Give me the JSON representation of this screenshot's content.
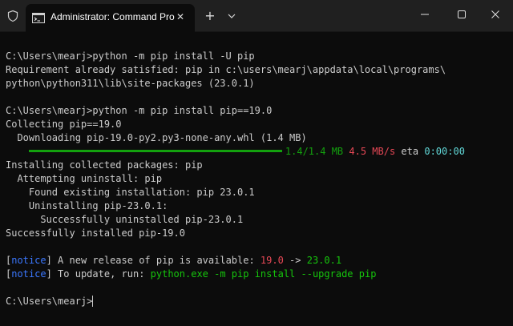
{
  "window": {
    "tab_title": "Administrator: Command Pro",
    "icons": {
      "shield": "shield-icon",
      "tab": "command-prompt-icon",
      "close_tab": "close-icon",
      "new_tab": "plus-icon",
      "dropdown": "chevron-down-icon",
      "minimize": "minimize-icon",
      "maximize": "maximize-icon",
      "close_window": "close-icon"
    }
  },
  "glyphs": {
    "close": "✕",
    "plus": "+"
  },
  "colors": {
    "background": "#0c0c0c",
    "titlebar": "#202020",
    "text": "#cccccc",
    "green": "#13a10e",
    "lime": "#16c60c",
    "red": "#e74856",
    "blue": "#3b78ff",
    "cyan": "#61d6d6"
  },
  "terminal": {
    "cmd1": "C:\\Users\\mearj>python -m pip install -U pip",
    "out1a": "Requirement already satisfied: pip in c:\\users\\mearj\\appdata\\local\\programs\\",
    "out1b": "python\\python311\\lib\\site-packages (23.0.1)",
    "cmd2": "C:\\Users\\mearj>python -m pip install pip==19.0",
    "collecting": "Collecting pip==19.0",
    "downloading": "  Downloading pip-19.0-py2.py3-none-any.whl (1.4 MB)",
    "progress": {
      "fraction": 1.0,
      "size": "1.4/1.4 MB",
      "speed": "4.5 MB/s",
      "eta_label": "eta",
      "eta": "0:00:00"
    },
    "installing": "Installing collected packages: pip",
    "attempting": "  Attempting uninstall: pip",
    "found": "    Found existing installation: pip 23.0.1",
    "uninstalling": "    Uninstalling pip-23.0.1:",
    "uninstalled": "      Successfully uninstalled pip-23.0.1",
    "installed": "Successfully installed pip-19.0",
    "notice1": {
      "open": "[",
      "tag": "notice",
      "close": "]",
      "text": " A new release of pip is available: ",
      "old_version": "19.0",
      "arrow": " -> ",
      "new_version": "23.0.1"
    },
    "notice2": {
      "open": "[",
      "tag": "notice",
      "close": "]",
      "text": " To update, run: ",
      "command": "python.exe -m pip install --upgrade pip"
    },
    "prompt": "C:\\Users\\mearj>"
  }
}
